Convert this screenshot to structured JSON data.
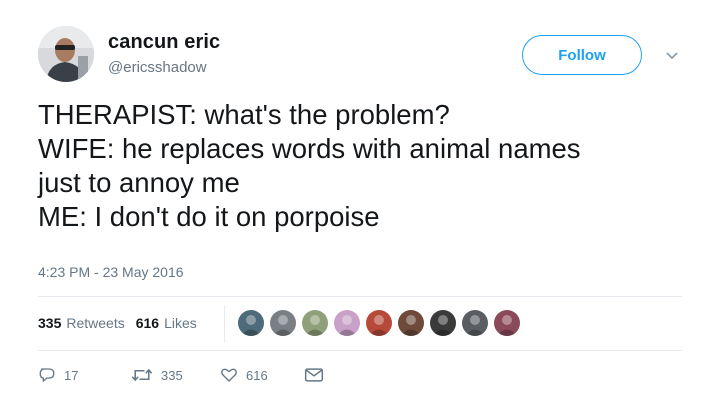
{
  "user": {
    "name": "cancun eric",
    "handle": "@ericsshadow"
  },
  "follow_label": "Follow",
  "tweet": {
    "lines": [
      "THERAPIST: what's the problem?",
      "WIFE: he replaces words with animal names",
      "just to annoy me",
      "ME: I don't do it on porpoise"
    ],
    "timestamp": "4:23 PM - 23 May 2016"
  },
  "stats": {
    "retweets_count": "335",
    "retweets_label": "Retweets",
    "likes_count": "616",
    "likes_label": "Likes"
  },
  "liker_colors": [
    "#4d6b7a",
    "#7a7f86",
    "#8fa07a",
    "#c9a0c8",
    "#b54a3a",
    "#6d4a3a",
    "#3a3a3a",
    "#5a5e63",
    "#8a4a5a"
  ],
  "actions": {
    "reply_count": "17",
    "retweet_count": "335",
    "like_count": "616"
  },
  "colors": {
    "accent": "#1da1f2",
    "text": "#14171a",
    "muted": "#657786",
    "border": "#e6ecf0"
  },
  "icons": [
    "chevron-down-icon",
    "reply-icon",
    "retweet-icon",
    "heart-icon",
    "envelope-icon"
  ]
}
